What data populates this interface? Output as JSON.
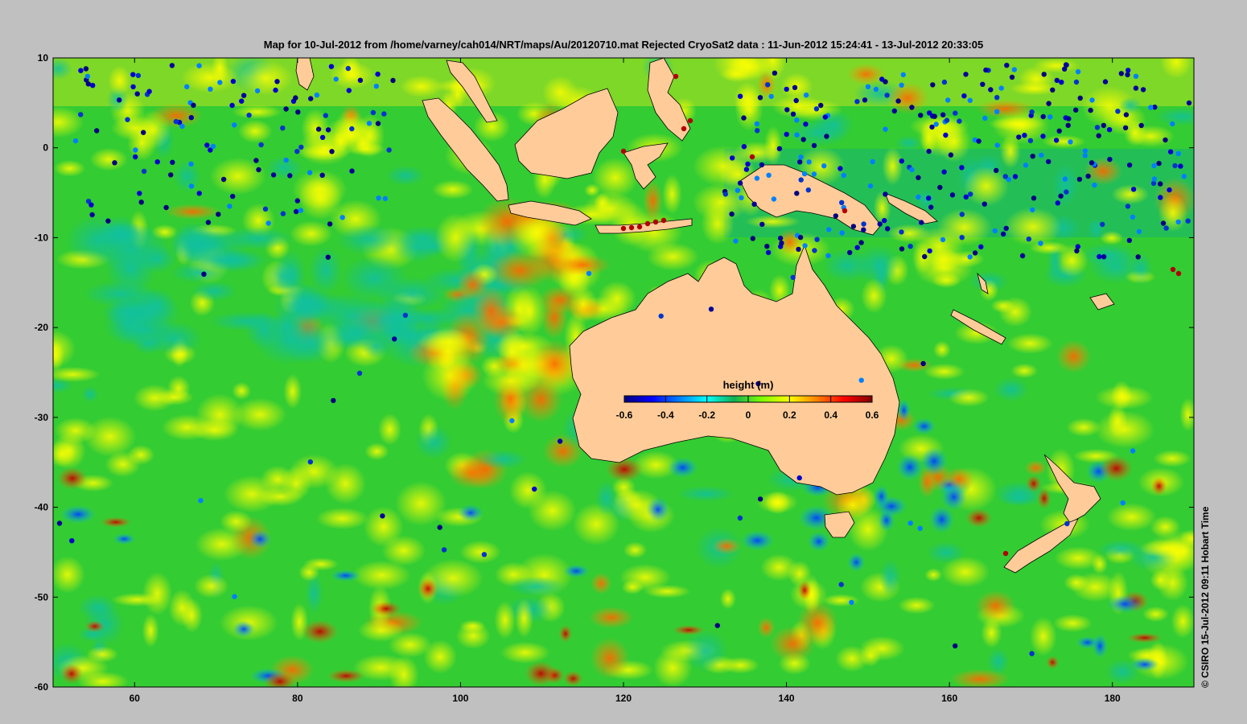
{
  "title": "Map for 10-Jul-2012 from /home/varney/cah014/NRT/maps/Au/20120710.mat  Rejected CryoSat2 data : 11-Jun-2012 15:24:41 - 13-Jul-2012 20:33:05",
  "credit": "© CSIRO 15-Jul-2012 09:11 Hobart Time",
  "colorbar": {
    "title": "height (m)",
    "range": [
      -0.6,
      0.6
    ],
    "tick_labels": [
      "-0.6",
      "-0.4",
      "-0.2",
      "0",
      "0.2",
      "0.4",
      "0.6"
    ],
    "colors": [
      "#00007f",
      "#0000ff",
      "#0080ff",
      "#00ffff",
      "#10b050",
      "#80ff00",
      "#ffff00",
      "#ff8000",
      "#ff0000",
      "#7f0000"
    ]
  },
  "map": {
    "lon_range": [
      50,
      190
    ],
    "lat_range": [
      -60,
      10
    ],
    "lon_ticks": [
      "60",
      "80",
      "100",
      "120",
      "140",
      "160",
      "180"
    ],
    "lat_ticks": [
      "10",
      "0",
      "-10",
      "-20",
      "-30",
      "-40",
      "-50",
      "-60"
    ],
    "land_color": "#ffcc99",
    "ocean_color": "#33cc33"
  }
}
